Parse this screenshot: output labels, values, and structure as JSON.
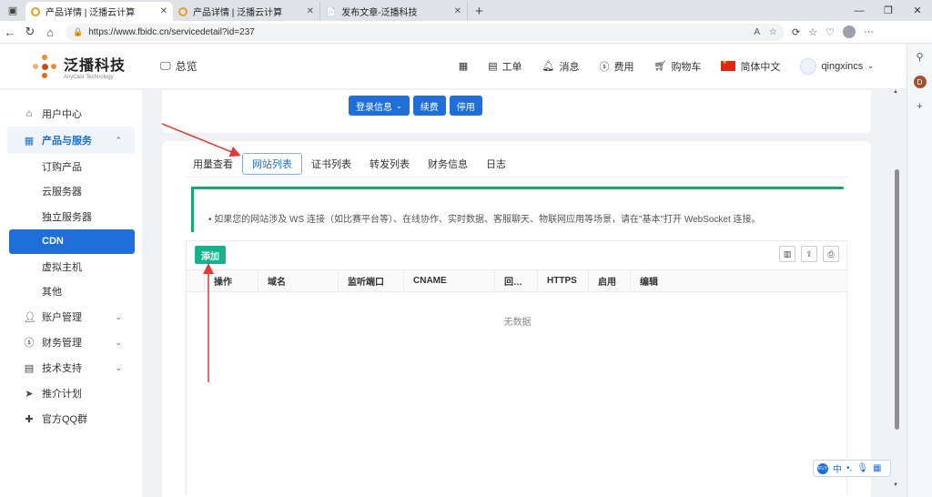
{
  "browser": {
    "tabs": [
      {
        "title": "产品详情 | 泛播云计算",
        "active": true
      },
      {
        "title": "产品详情 | 泛播云计算",
        "active": false
      },
      {
        "title": "发布文章-泛播科技",
        "active": false
      }
    ],
    "url": "https://www.fbidc.cn/servicedetail?id=237"
  },
  "header": {
    "logo_cn": "泛播科技",
    "logo_en": "AnyCast Technology",
    "overview": "总览",
    "ticket": "工单",
    "message": "消息",
    "fee": "费用",
    "cart": "购物车",
    "language": "简体中文",
    "username": "qingxincs"
  },
  "sidebar": {
    "user_center": "用户中心",
    "products": "产品与服务",
    "sub_items": [
      "订购产品",
      "云服务器",
      "独立服务器",
      "CDN",
      "虚拟主机",
      "其他"
    ],
    "active_sub": "CDN",
    "account": "账户管理",
    "finance": "财务管理",
    "support": "技术支持",
    "referral": "推介计划",
    "qq_group": "官方QQ群"
  },
  "top_actions": {
    "login_info": "登录信息",
    "renew": "续费",
    "disable": "停用"
  },
  "tabs": [
    "用量查看",
    "网站列表",
    "证书列表",
    "转发列表",
    "财务信息",
    "日志"
  ],
  "active_tab": "网站列表",
  "notice": "如果您的网站涉及 WS 连接（如比赛平台等）、在线协作、实时数据、客服聊天、物联网应用等场景，请在\"基本\"打开 WebSocket 连接。",
  "table": {
    "add_label": "添加",
    "columns": [
      "操作",
      "域名",
      "监听端口",
      "CNAME",
      "回…",
      "HTTPS",
      "启用",
      "编辑"
    ],
    "empty_text": "无数据"
  },
  "ime": {
    "lang": "中"
  }
}
